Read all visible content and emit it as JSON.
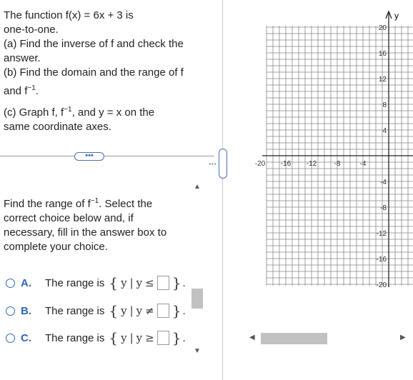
{
  "problem": {
    "line1": "The function f(x) = 6x + 3 is",
    "line2": "one-to-one.",
    "line3": "(a) Find the inverse of f and check the",
    "line4": "answer.",
    "line5": "(b) Find the domain and the range of f",
    "line6_pre": "and f",
    "line6_sup": "−1",
    "line6_post": ".",
    "line7_pre": "(c) Graph f, f",
    "line7_sup": "−1",
    "line7_post": ", and y = x on the",
    "line8": "same coordinate axes."
  },
  "expand_button": "•••",
  "question": {
    "line1_pre": "Find the range of f",
    "line1_sup": "−1",
    "line1_post": ". Select the",
    "line2": "correct choice below and, if",
    "line3": "necessary, fill in the answer box to",
    "line4": "complete your choice."
  },
  "choices": [
    {
      "letter": "A.",
      "text": "The range is",
      "set_open": "{",
      "var": "y",
      "bar": "|",
      "var2": "y",
      "rel": "≤",
      "set_close": "}",
      "end": "."
    },
    {
      "letter": "B.",
      "text": "The range is",
      "set_open": "{",
      "var": "y",
      "bar": "|",
      "var2": "y",
      "rel": "≠",
      "set_close": "}",
      "end": "."
    },
    {
      "letter": "C.",
      "text": "The range is",
      "set_open": "{",
      "var": "y",
      "bar": "|",
      "var2": "y",
      "rel": "≥",
      "set_close": "}",
      "end": "."
    }
  ],
  "graph": {
    "y_axis_label": "y",
    "x_tick_labels": [
      "-20",
      "-16",
      "-12",
      "-8",
      "-4"
    ],
    "y_tick_labels_pos": [
      "20",
      "16",
      "12",
      "8",
      "4"
    ],
    "y_tick_labels_neg": [
      "-4",
      "-8",
      "-12",
      "-16",
      "-20"
    ]
  },
  "colors": {
    "accent": "#2f67b8"
  }
}
